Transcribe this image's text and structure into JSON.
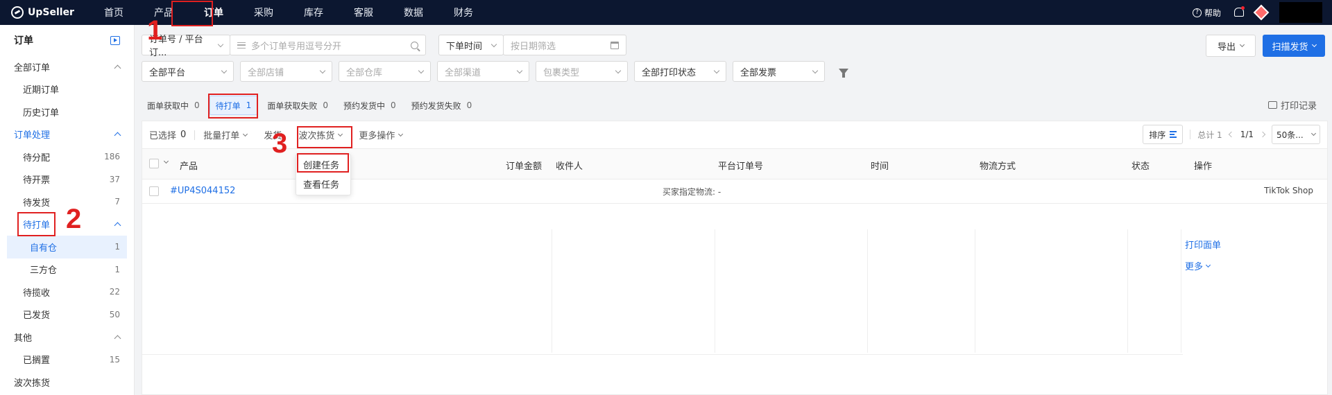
{
  "app": {
    "name": "UpSeller"
  },
  "nav": {
    "items": [
      "首页",
      "产品",
      "订单",
      "采购",
      "库存",
      "客服",
      "数据",
      "财务"
    ],
    "active_index": 2,
    "help": "帮助"
  },
  "sidebar": {
    "title": "订单",
    "all_orders": "全部订单",
    "recent_orders": "近期订单",
    "history_orders": "历史订单",
    "processing": "订单处理",
    "to_assign": {
      "label": "待分配",
      "count": "186"
    },
    "to_invoice": {
      "label": "待开票",
      "count": "37"
    },
    "to_ship": {
      "label": "待发货",
      "count": "7"
    },
    "to_print": {
      "label": "待打单"
    },
    "own_warehouse": {
      "label": "自有仓",
      "count": "1"
    },
    "third_warehouse": {
      "label": "三方仓",
      "count": "1"
    },
    "to_pickup": {
      "label": "待揽收",
      "count": "22"
    },
    "shipped": {
      "label": "已发货",
      "count": "50"
    },
    "other": "其他",
    "shelved": {
      "label": "已搁置",
      "count": "15"
    },
    "wave_picking": "波次拣货"
  },
  "filters": {
    "order_type": "订单号 / 平台订...",
    "search_placeholder": "多个订单号用逗号分开",
    "time_type": "下单时间",
    "date_placeholder": "按日期筛选",
    "platform": "全部平台",
    "store": "全部店铺",
    "warehouse": "全部仓库",
    "channel": "全部渠道",
    "package_type": "包裹类型",
    "print_status": "全部打印状态",
    "invoice": "全部发票",
    "export": "导出",
    "scan_ship": "扫描发货"
  },
  "tabs": [
    {
      "label": "面单获取中",
      "count": "0"
    },
    {
      "label": "待打单",
      "count": "1"
    },
    {
      "label": "面单获取失败",
      "count": "0"
    },
    {
      "label": "预约发货中",
      "count": "0"
    },
    {
      "label": "预约发货失败",
      "count": "0"
    }
  ],
  "print_log": "打印记录",
  "toolbar": {
    "selected": "已选择",
    "selected_count": "0",
    "batch_print": "批量打单",
    "ship": "发货",
    "wave_picking": "波次拣货",
    "more_ops": "更多操作",
    "sort": "排序",
    "total": "总计 1",
    "page": "1/1",
    "page_size": "50条..."
  },
  "dropdown": {
    "create_task": "创建任务",
    "view_task": "查看任务"
  },
  "table": {
    "headers": [
      "产品",
      "订单金额",
      "收件人",
      "平台订单号",
      "时间",
      "物流方式",
      "状态",
      "操作"
    ],
    "order_no": "#UP4S044152",
    "buyer_logistics": "买家指定物流: -",
    "shop": "TikTok Shop",
    "print_label": "打印面单",
    "more": "更多"
  },
  "annotations": [
    "1",
    "2",
    "3"
  ],
  "colors": {
    "nav_bg": "#0c1730",
    "primary": "#1f6fe5",
    "annotation": "#e02020"
  }
}
